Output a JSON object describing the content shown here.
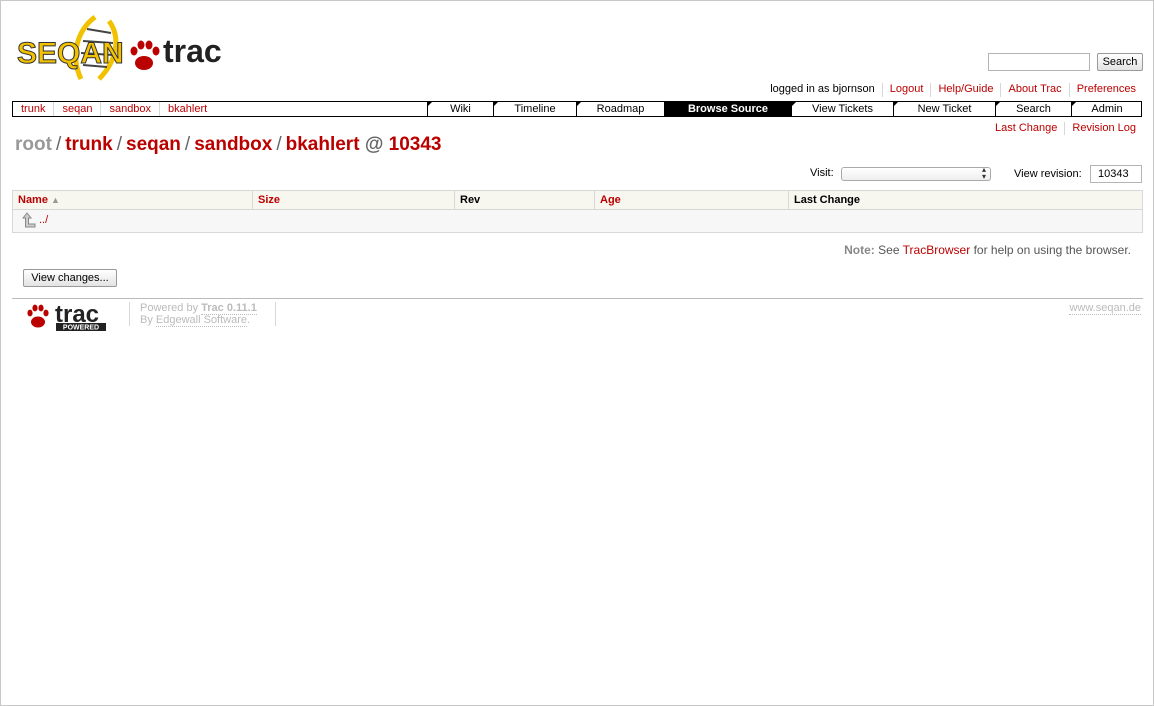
{
  "search": {
    "button_label": "Search",
    "value": ""
  },
  "metanav": {
    "user_text": "logged in as bjornson",
    "logout": "Logout",
    "help": "Help/Guide",
    "about": "About Trac",
    "preferences": "Preferences"
  },
  "ctxt": [
    "trunk",
    "seqan",
    "sandbox",
    "bkahlert"
  ],
  "mainnav": [
    {
      "label": "Wiki",
      "active": false
    },
    {
      "label": "Timeline",
      "active": false
    },
    {
      "label": "Roadmap",
      "active": false
    },
    {
      "label": "Browse Source",
      "active": true
    },
    {
      "label": "View Tickets",
      "active": false
    },
    {
      "label": "New Ticket",
      "active": false
    },
    {
      "label": "Search",
      "active": false
    },
    {
      "label": "Admin",
      "active": false
    }
  ],
  "subnav": {
    "last_change": "Last Change",
    "revision_log": "Revision Log"
  },
  "path": {
    "root": "root",
    "parts": [
      "trunk",
      "seqan",
      "sandbox",
      "bkahlert"
    ],
    "separator": "/",
    "at": "@",
    "revision": "10343"
  },
  "visit": {
    "label": "Visit:",
    "selected": ""
  },
  "view_revision": {
    "label": "View revision:",
    "value": "10343"
  },
  "listing": {
    "columns": [
      "Name",
      "Size",
      "Rev",
      "Age",
      "Last Change"
    ],
    "parent_link": "../"
  },
  "note": {
    "label": "Note:",
    "pre": "See",
    "link": "TracBrowser",
    "post": "for help on using the browser."
  },
  "view_changes_button": "View changes...",
  "footer": {
    "powered_by": "Powered by",
    "trac_version": "Trac 0.11.1",
    "by": "By",
    "edgewall": "Edgewall Software",
    "edgewall_suffix": ".",
    "site": "www.seqan.de",
    "trac_logo_text": "trac",
    "trac_logo_sub": "POWERED"
  },
  "logo": {
    "seqan": "SEQAN",
    "trac": "trac"
  },
  "colors": {
    "link": "#bb0000",
    "active_tab_bg": "#000000",
    "header_bg": "#f7f7f0"
  }
}
